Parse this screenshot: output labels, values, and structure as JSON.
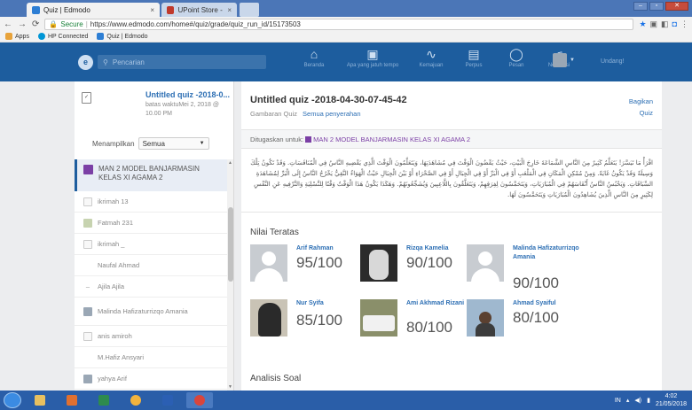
{
  "browser": {
    "tabs": [
      {
        "label": "Quiz | Edmodo",
        "close": "×"
      },
      {
        "label": "UPoint Store - Steam Po",
        "close": "×"
      }
    ],
    "url_secure": "Secure",
    "url": "https://www.edmodo.com/home#/quiz/grade/quiz_run_id/15173503",
    "bookmarks": [
      "Apps",
      "HP Connected",
      "Quiz | Edmodo"
    ]
  },
  "topnav": {
    "search_placeholder": "Pencarian",
    "items": [
      "Beranda",
      "Apa yang jatuh tempo",
      "Kemajuan",
      "Perpus",
      "Pesan",
      "Notifikasi"
    ],
    "upgrade": "Undang!"
  },
  "sidebar": {
    "quiz_title": "Untitled quiz -2018-0...",
    "due_label": "batas waktuMei 2, 2018 @",
    "due_time": "10.00 PM",
    "filter_label": "Menampilkan",
    "filter_value": "Semua",
    "group_name": "MAN 2 MODEL BANJARMASIN KELAS XI AGAMA 2",
    "students": [
      "ikrimah 13",
      "Fatmah 231",
      "ikrimah _",
      "Naufal Ahmad",
      "Ajila Ajila",
      "Malinda Hafizaturrizqo Amania",
      "anis amiroh",
      "M.Hafiz Ansyari",
      "yahya Arif"
    ]
  },
  "main": {
    "title": "Untitled quiz -2018-04-30-07-45-42",
    "link_overview": "Gambaran Quiz",
    "link_submissions": "Semua penyerahan",
    "share_label": "Bagikan",
    "share_label2": "Quiz",
    "assigned_label": "Ditugaskan untuk:",
    "assigned_group": "MAN 2 MODEL BANJARMASIN KELAS XI AGAMA 2",
    "description": "اقْرَأْ مَا تَيَسَّرَ! يَتَعَلَّمُ كَثِيرٌ مِنَ النَّاسِ الشَّمَاعَةَ خَارِجَ الْبَيْتِ، حَيْثُ يَقْضُونَ الْوَقْتَ فِي مُشَاهَدَتِهَا، وَيَتَعَلَّمُونَ الْوَقْتَ الَّذِي يَقْضِيهِ النَّاسُ فِي الْمُنَافَسَاتِ. وَقَدْ تَكُونُ تِلْكَ وَسِيلَةً وَقَدْ يَكُونُ غَايَةً. وَمِنْ مُمْكِنِ الْمَكَانِ فِي الْمَلْعَبِ أَوْ فِي الْبَرِّ أَوْ فِي الْجِبَالِ أَوْ فِي الصَّحْرَاءِ أَوْ بَيْنَ الْجِبَالِ حَيْثُ الْهَوَاءُ النَّقِيُّ يَخْرُجُ النَّاسُ إِلَى الْبَرِّ لِمُشَاهَدَةِ السِّبَاقَاتِ. وَيَحْبُسُ النَّاسُ أَنْفَاسَهُمْ فِي الْمُبَارَيَاتِ، وَيَتَحَمَّسُونَ لِفِرَقِهِمْ، وَيَتَعَلَّقُونَ بِاللَّاعِبِينَ وَيُشَجِّعُونَهُمْ. وَهَكَذَا يَكُونُ هَذَا الْوَقْتُ وَقْتًا لِلتَّسْلِيَةِ وَالتَّرْفِيهِ عَنِ النَّفْسِ لِكَثِيرٍ مِنَ النَّاسِ الَّذِينَ يُشَاهِدُونَ الْمُبَارَيَاتِ وَيَتَحَمَّسُونَ لَهَا.",
    "top_scores_title": "Nilai Teratas",
    "top_scores": [
      {
        "name": "Arif Rahman",
        "score": "95/100"
      },
      {
        "name": "Rizqa Kamelia",
        "score": "90/100"
      },
      {
        "name": "Malinda Hafizaturrizqo Amania",
        "score": "90/100"
      },
      {
        "name": "Nur Syifa",
        "score": "85/100"
      },
      {
        "name": "Ami Akhmad Rizani",
        "score": "80/100"
      },
      {
        "name": "Ahmad Syaiful",
        "score": "80/100"
      }
    ],
    "analysis_title": "Analisis Soal"
  },
  "taskbar": {
    "lang": "IN",
    "time": "4:02",
    "date": "21/05/2018"
  }
}
